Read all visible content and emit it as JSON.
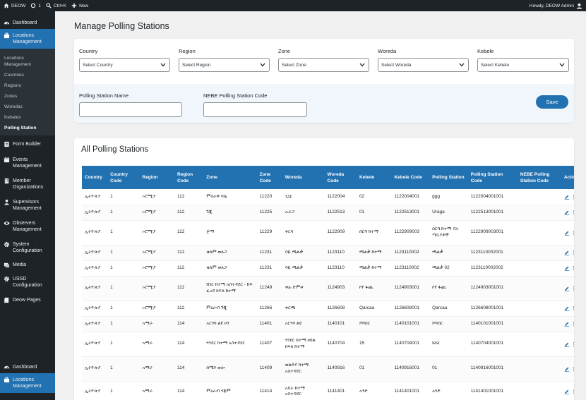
{
  "adminbar": {
    "site_name": "DEOW",
    "updates_count": "1",
    "search_shortcut": "Ctrl+K",
    "new_label": "New",
    "greeting": "Howdy, DEOW Admin"
  },
  "sidebar": {
    "top_items": [
      {
        "label": "Dashboard",
        "icon": "dashboard-icon"
      },
      {
        "label": "Locations Management",
        "icon": "briefcase-icon",
        "active": true
      }
    ],
    "submenu": [
      "Locations Management",
      "Countries",
      "Regions",
      "Zones",
      "Woredas",
      "Kebeles",
      "Polling Station"
    ],
    "submenu_current": "Polling Station",
    "items": [
      {
        "label": "Form Builder",
        "icon": "form-icon"
      },
      {
        "label": "Events Management",
        "icon": "calendar-icon"
      },
      {
        "label": "Member Organizations",
        "icon": "building-icon"
      },
      {
        "label": "Supervisors Management",
        "icon": "supervisor-icon"
      },
      {
        "label": "Observers Management",
        "icon": "eye-icon"
      },
      {
        "label": "System Configuration",
        "icon": "gear-icon"
      },
      {
        "label": "Media",
        "icon": "media-icon"
      },
      {
        "label": "USSD Configuration",
        "icon": "gear-icon"
      },
      {
        "label": "Deow Pages",
        "icon": "pages-icon"
      }
    ],
    "bottom_items": [
      {
        "label": "Dashboard",
        "icon": "dashboard-icon"
      },
      {
        "label": "Locations Management",
        "icon": "briefcase-icon",
        "active": true
      }
    ]
  },
  "page_title": "Manage Polling Stations",
  "filters": {
    "country": {
      "label": "Country",
      "placeholder": "Select Country"
    },
    "region": {
      "label": "Region",
      "placeholder": "Select Region"
    },
    "zone": {
      "label": "Zone",
      "placeholder": "Select Zone"
    },
    "woreda": {
      "label": "Woreda",
      "placeholder": "Select Woreda"
    },
    "kebele": {
      "label": "Kebele",
      "placeholder": "Select Kebele"
    },
    "station_name": {
      "label": "Polling Station Name",
      "value": ""
    },
    "nebe_code": {
      "label": "NEBE Polling Station Code",
      "value": ""
    },
    "save_label": "Save"
  },
  "list": {
    "title": "All Polling Stations",
    "columns": [
      "Country",
      "Country Code",
      "Region",
      "Region Code",
      "Zone",
      "Zone Code",
      "Woreda",
      "Woreda Code",
      "Kebele",
      "Kebele Code",
      "Polling Station",
      "Polling Station Code",
      "NEBE Polling Station Code",
      "Actions"
    ],
    "rows": [
      [
        "ኢትዮጵያ",
        "1",
        "ኦሮሚያ",
        "112",
        "ምስራቅ ባሌ",
        "11220",
        "ጊኒር",
        "1122004",
        "02",
        "1122004001",
        "ggg",
        "1122004001001",
        ""
      ],
      [
        "ኢትዮጵያ",
        "1",
        "ኦሮሚያ",
        "112",
        "ጉጂ",
        "11225",
        "ኡራጋ",
        "1122513",
        "01",
        "1122513001",
        "Uraga",
        "1122513001001",
        ""
      ],
      [
        "ኢትዮጵያ",
        "1",
        "ኦሮሚያ",
        "112",
        "ጅማ",
        "11229",
        "ቀርሳ",
        "1122909",
        "ሰርባ ከተማ",
        "1122909003",
        "ሰርባ ከተማ ያሉ ጣቢያዎች",
        "1122909003001",
        ""
      ],
      [
        "ኢትዮጵያ",
        "1",
        "ኦሮሚያ",
        "112",
        "ቄለም ወለጋ",
        "11231",
        "ሳዪ ጫልቃ",
        "1123110",
        "ጫልቃ ከተማ",
        "1123110002",
        "ጫልቃ",
        "1123110002001",
        ""
      ],
      [
        "ኢትዮጵያ",
        "1",
        "ኦሮሚያ",
        "112",
        "ቄለም ወለጋ",
        "11231",
        "ሳዪ ጫልቃ",
        "1123110",
        "ጫልቃ ከተማ",
        "1123110002",
        "ጫልቃ 02",
        "1123110002002",
        ""
      ],
      [
        "ኢትዮጵያ",
        "1",
        "ኦሮሚያ",
        "112",
        "ሸገር ከተማ አስተዳደር - ከፍ ፈረደ ክፍለ ከተማ",
        "11249",
        "ቱሉ ድምቱ",
        "1124903",
        "ኮየ ፋጪ",
        "1124903001",
        "ኮየ ፋጪ",
        "1124903001001",
        ""
      ],
      [
        "ኢትዮጵያ",
        "1",
        "ኦሮሚያ",
        "112",
        "ምዕራብ ጉጂ",
        "11266",
        "ቀርጫ",
        "1126608",
        "Qarcaa",
        "1126608001",
        "Qarcaa",
        "1126608001001",
        ""
      ],
      [
        "ኢትዮጵያ",
        "1",
        "አማራ",
        "114",
        "አርጎባ ልዩ ዞን",
        "11401",
        "አርጎባ ልዩ",
        "1140101",
        "ሾሻበር",
        "1140101001",
        "ሾሻበር",
        "1140101001001",
        ""
      ],
      [
        "ኢትዮጵያ",
        "1",
        "አማራ",
        "114",
        "ጎንደር ከተማ አስተዳደር",
        "11407",
        "ጎንደር ከተማ ዞበል ክፍለ ከተማ",
        "1140704",
        "15",
        "1140704001",
        "test",
        "1140704001001",
        ""
      ],
      [
        "ኢትዮጵያ",
        "1",
        "አማራ",
        "114",
        "ሰሜን ወሎ",
        "11409",
        "ወልድያ ከተማ አስተዳደር",
        "1140916",
        "01",
        "1140916001",
        "01",
        "1140916001001",
        ""
      ],
      [
        "ኢትዮጵያ",
        "1",
        "አማራ",
        "114",
        "ምዕራብ ጎጃም",
        "11414",
        "አዴት ከተማ አስተዳደር",
        "1141401",
        "አንድ",
        "1141401001",
        "አንድ",
        "1141401001001",
        ""
      ]
    ]
  },
  "colors": {
    "accent": "#2271b1",
    "sidebar": "#1d2327",
    "submenu": "#2c3338"
  }
}
